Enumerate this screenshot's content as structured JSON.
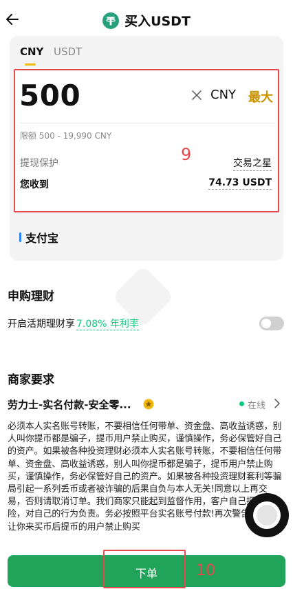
{
  "header": {
    "title": "买入USDT",
    "back_icon": "arrow-left-icon",
    "coin_icon": "tether-icon"
  },
  "tabs": [
    {
      "label": "CNY",
      "active": true
    },
    {
      "label": "USDT",
      "active": false
    }
  ],
  "amount_panel": {
    "amount_value": "500",
    "currency": "CNY",
    "max_label": "最大",
    "limit_text": "限额 500 - 19,990 CNY",
    "protection_label": "提现保护",
    "protection_value": "交易之星",
    "receive_label": "您收到",
    "receive_value": "74.73 USDT"
  },
  "payment": {
    "method": "支付宝"
  },
  "annotations": {
    "box1": "9",
    "box2": "10"
  },
  "finance": {
    "title": "申购理财",
    "flex_label": "开启活期理财享",
    "rate_text": "7.08% 年利率",
    "toggle_on": false
  },
  "merchant": {
    "title": "商家要求",
    "name": "劳力士-实名付款-安全零...",
    "status": "在线",
    "terms": "必须本人实名账号转账，不要相信任何带单、资金盘、高收益诱惑，别人叫你提币都是骗子，提币用户禁止购买，谨慎操作，务必保管好自己的资产。如果被各种投资理财必须本人实名账号转账，不要相信任何带单、资金盘、高收益诱惑，别人叫你提币都是骗子，提币用户禁止购买，谨慎操作，务必保管好自己的资产。如果被各种投资理财套利等骗局引起一系列丢币或者被诈骗的后果自负与本人无关!同意以上再交易，否则请取消订单。我们商家只能起到监督作用，客户自己把控风险，对自己的行为负责。务必按照平台实名账号付款!再次警告，别人让你来买币后提币的用户禁止购买"
  },
  "bottom": {
    "order_label": "下单"
  },
  "colors": {
    "accent": "#f0b90b",
    "green": "#22a35a",
    "annotation_red": "#e5484d"
  }
}
